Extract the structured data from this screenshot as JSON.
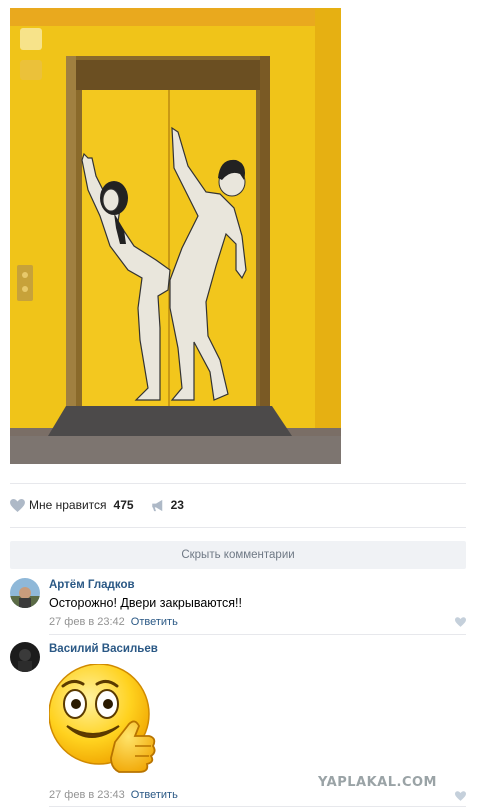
{
  "post": {
    "image_description": "",
    "likes": {
      "label": "Мне нравится",
      "count": "475"
    },
    "shares": {
      "count": "23"
    },
    "hide_comments_label": "Скрыть комментарии"
  },
  "comments": [
    {
      "author": "Артём Гладков",
      "text": "Осторожно! Двери закрываются!!",
      "date": "27 фев в 23:42",
      "reply_label": "Ответить"
    },
    {
      "author": "Василий Васильев",
      "text": "",
      "date": "27 фев в 23:43",
      "reply_label": "Ответить"
    }
  ],
  "watermark": "YAPLAKAL.COM",
  "colors": {
    "link": "#2a5885",
    "meta": "#939393",
    "icon": "#aeb9c7",
    "wall_yellow": "#f1c40f",
    "separator": "#e7e8ec"
  },
  "icons": {
    "like": "heart-icon",
    "share": "megaphone-icon",
    "comment_like": "heart-icon"
  }
}
